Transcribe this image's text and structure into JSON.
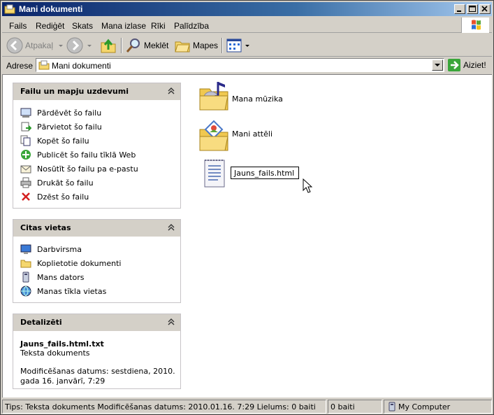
{
  "window": {
    "title": "Mani dokumenti"
  },
  "menu": {
    "items": [
      "Fails",
      "Rediģēt",
      "Skats",
      "Mana izlase",
      "Rīki",
      "Palīdzība"
    ]
  },
  "toolbar": {
    "back": "Atpakaļ",
    "search": "Meklēt",
    "folders": "Mapes"
  },
  "address": {
    "label": "Adrese",
    "value": "Mani dokumenti",
    "go": "Aiziet!"
  },
  "tasks_panel": {
    "title": "Failu un mapju uzdevumi",
    "items": [
      {
        "label": "Pārdēvēt šo failu",
        "icon": "rename-icon"
      },
      {
        "label": "Pārvietot šo failu",
        "icon": "move-icon"
      },
      {
        "label": "Kopēt šo failu",
        "icon": "copy-icon"
      },
      {
        "label": "Publicēt šo failu tīklā Web",
        "icon": "publish-web-icon"
      },
      {
        "label": "Nosūtīt šo failu pa e-pastu",
        "icon": "email-icon"
      },
      {
        "label": "Drukāt šo failu",
        "icon": "print-icon"
      },
      {
        "label": "Dzēst šo failu",
        "icon": "delete-icon"
      }
    ]
  },
  "places_panel": {
    "title": "Citas vietas",
    "items": [
      {
        "label": "Darbvirsma",
        "icon": "desktop-icon"
      },
      {
        "label": "Koplietotie dokumenti",
        "icon": "folder-icon"
      },
      {
        "label": "Mans dators",
        "icon": "computer-icon"
      },
      {
        "label": "Manas tīkla vietas",
        "icon": "network-icon"
      }
    ]
  },
  "details_panel": {
    "title": "Detalizēti",
    "name": "Jauns_fails.html.txt",
    "type": "Teksta dokuments",
    "modified_line1": "Modificēšanas datums: sestdiena, 2010.",
    "modified_line2": "gada 16. janvārī, 7:29"
  },
  "files": [
    {
      "label": "Mana mūzika",
      "icon": "music-folder-icon"
    },
    {
      "label": "Mani attēli",
      "icon": "pictures-folder-icon"
    }
  ],
  "rename": {
    "value": "Jauns_fails.html",
    "icon": "text-document-icon"
  },
  "status": {
    "tips": "Tips: Teksta dokuments Modificēšanas datums: 2010.01.16. 7:29 Lielums: 0 baiti",
    "size": "0 baiti",
    "zone": "My Computer"
  },
  "colors": {
    "title_start": "#0a246a",
    "title_end": "#a6caf0",
    "chrome": "#d4d0c8"
  }
}
